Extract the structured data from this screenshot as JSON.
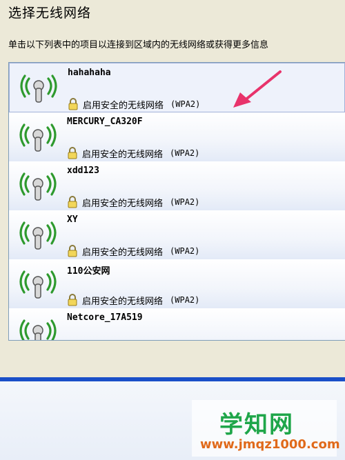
{
  "header": {
    "title": "选择无线网络",
    "description": "单击以下列表中的项目以连接到区域内的无线网络或获得更多信息"
  },
  "networks": [
    {
      "ssid": "hahahaha",
      "security": "启用安全的无线网络",
      "security_type": "(WPA2)"
    },
    {
      "ssid": "MERCURY_CA320F",
      "security": "启用安全的无线网络",
      "security_type": "(WPA2)"
    },
    {
      "ssid": "xdd123",
      "security": "启用安全的无线网络",
      "security_type": "(WPA2)"
    },
    {
      "ssid": "XY",
      "security": "启用安全的无线网络",
      "security_type": "(WPA2)"
    },
    {
      "ssid": "110公安网",
      "security": "启用安全的无线网络",
      "security_type": "(WPA2)"
    },
    {
      "ssid": "Netcore_17A519",
      "security": "",
      "security_type": ""
    }
  ],
  "watermark": {
    "main": "学知网",
    "url": "www.jmqz1000.com"
  },
  "colors": {
    "accent": "#1a4fc8",
    "annotation_arrow": "#e8336b",
    "watermark_green": "#1fa64a",
    "watermark_orange": "#e06a1a"
  },
  "icons": {
    "signal": "wireless-signal-icon",
    "lock": "lock-icon"
  }
}
